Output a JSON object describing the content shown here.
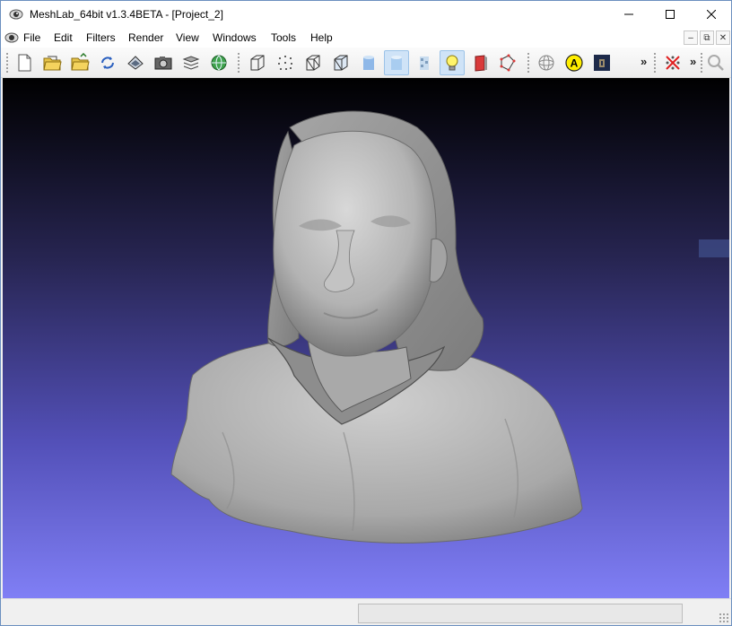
{
  "window": {
    "title": "MeshLab_64bit v1.3.4BETA - [Project_2]",
    "app_icon": "meshlab-eye-icon",
    "controls": [
      "minimize-icon",
      "maximize-icon",
      "close-icon"
    ]
  },
  "menubar": {
    "items": [
      {
        "label": "File"
      },
      {
        "label": "Edit"
      },
      {
        "label": "Filters"
      },
      {
        "label": "Render"
      },
      {
        "label": "View"
      },
      {
        "label": "Windows"
      },
      {
        "label": "Tools"
      },
      {
        "label": "Help"
      }
    ],
    "mdi_controls": [
      "mdi-minimize-icon",
      "mdi-restore-icon",
      "mdi-close-icon"
    ]
  },
  "toolbar": {
    "groups": [
      [
        "new-project-icon",
        "open-project-icon",
        "open-mesh-icon",
        "reload-icon",
        "save-icon",
        "snapshot-icon",
        "layers-icon",
        "globe-icon"
      ],
      [
        "bbox-icon",
        "points-icon",
        "wireframe-icon",
        "hidden-lines-icon",
        "flat-icon",
        "smooth-icon",
        "texture-icon",
        "light-on-icon",
        "double-side-icon",
        "cull-icon"
      ],
      [
        "trackball-icon",
        "annotate-icon",
        "measure-icon"
      ],
      [
        "cut-icon"
      ],
      [
        "zoom-icon"
      ]
    ],
    "overflow_label": "»",
    "active": [
      "smooth-icon",
      "light-on-icon"
    ]
  },
  "viewport": {
    "gradient_top": "#000000",
    "gradient_bottom": "#807ff5",
    "mesh_color": "#b8b8b8",
    "content": "3d-scanned-bust-mesh"
  },
  "statusbar": {
    "text": ""
  }
}
